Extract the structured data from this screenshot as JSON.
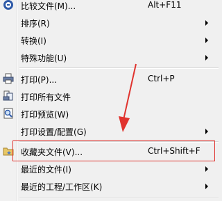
{
  "menu": {
    "items": [
      {
        "label": "比较文件(M)...",
        "shortcut": "Alt+F11"
      },
      {
        "label": "排序(R)"
      },
      {
        "label": "转换(I)"
      },
      {
        "label": "特殊功能(U)"
      },
      {
        "label": "打印(P)...",
        "shortcut": "Ctrl+P"
      },
      {
        "label": "打印所有文件"
      },
      {
        "label": "打印预览(W)"
      },
      {
        "label": "打印设置/配置(G)"
      },
      {
        "label": "收藏夹文件(V)...",
        "shortcut": "Ctrl+Shift+F"
      },
      {
        "label": "最近的文件(I)"
      },
      {
        "label": "最近的工程/工作区(K)"
      }
    ]
  },
  "colors": {
    "highlight_border": "#e0332e",
    "menu_bg": "#f0f0f0"
  },
  "icons": [
    "compare-icon",
    "printer-icon",
    "print-all-icon",
    "print-preview-icon",
    "favorites-folder-icon"
  ]
}
